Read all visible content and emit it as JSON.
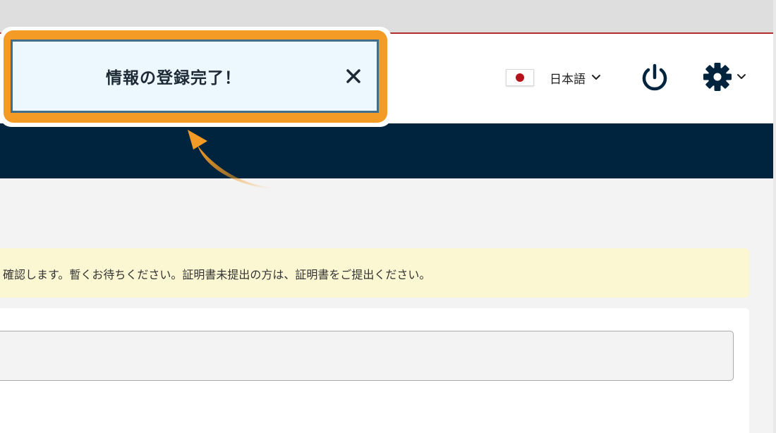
{
  "header": {
    "language": {
      "label": "日本語",
      "flag_icon": "japan-flag-icon",
      "chevron_icon": "chevron-down-icon"
    },
    "power_icon": "power-icon",
    "settings_icon": "gear-icon",
    "settings_chevron_icon": "chevron-down-icon"
  },
  "notice": {
    "text": "確認します。暫くお待ちください。証明書未提出の方は、証明書をご提出ください。"
  },
  "toast": {
    "message": "情報の登録完了！",
    "close_icon": "close-icon"
  },
  "colors": {
    "navbar": "#00233e",
    "highlight": "#f39b24",
    "toast_bg": "#ecf7fe",
    "toast_border": "#3f6e8e",
    "notice_bg": "#fcf7d3",
    "flag_red": "#b5121b"
  }
}
